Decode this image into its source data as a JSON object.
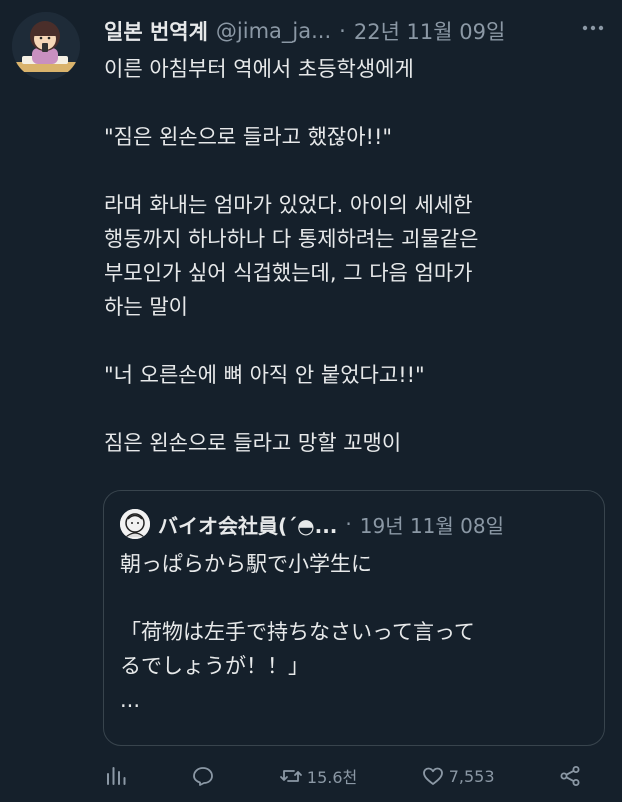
{
  "author": {
    "display_name": "일본 번역계",
    "handle": "@jima_ja...",
    "separator": "·",
    "timestamp": "22년 11월 09일",
    "more_icon": "more-horizontal-icon"
  },
  "tweet": {
    "paragraphs": [
      "이른 아침부터 역에서 초등학생에게",
      "\"짐은 왼손으로 들라고 했잖아!!\"",
      "라며 화내는 엄마가 있었다. 아이의 세세한\n행동까지 하나하나 다 통제하려는 괴물같은\n부모인가 싶어 식겁했는데, 그 다음 엄마가\n하는 말이",
      "\"너 오른손에 뼈 아직 안 붙었다고!!\"",
      "짐은 왼손으로 들라고 망할 꼬맹이"
    ]
  },
  "quoted_tweet": {
    "display_name": "バイオ会社員(´◓...",
    "separator": "·",
    "timestamp": "19년 11월 08일",
    "paragraphs": [
      "朝っぱらから駅で小学生に",
      "「荷物は左手で持ちなさいって言って\nるでしょうが！！」\n..."
    ]
  },
  "actions": {
    "views_icon": "views-chart-icon",
    "reply_icon": "reply-icon",
    "retweet_icon": "retweet-icon",
    "retweet_count": "15.6천",
    "like_icon": "heart-icon",
    "like_count": "7,553",
    "share_icon": "share-icon"
  },
  "colors": {
    "background": "#15202b",
    "text_primary": "#e7e9ea",
    "text_secondary": "#8b98a5",
    "border": "#38444d"
  }
}
